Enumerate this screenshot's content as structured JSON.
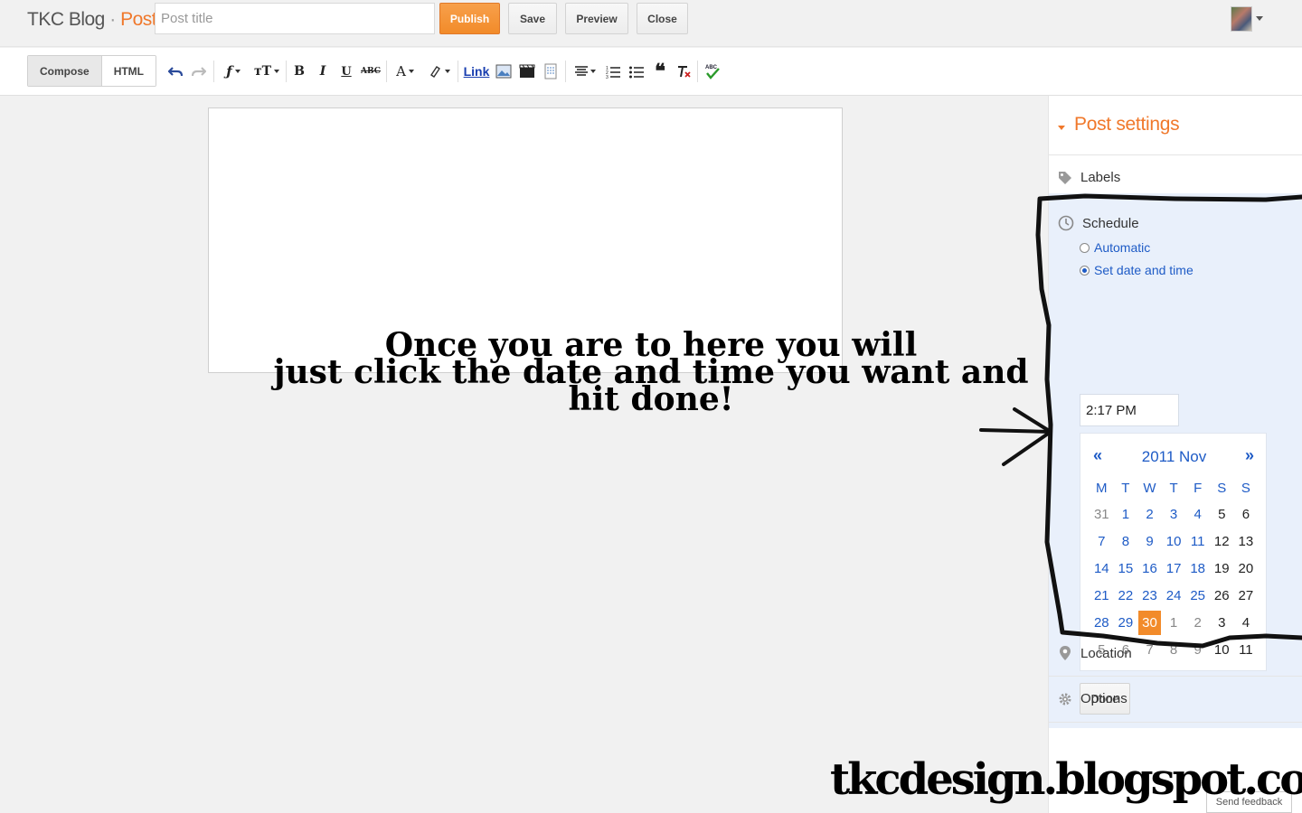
{
  "header": {
    "blog_name": "TKC Blog",
    "separator": "·",
    "page_label": "Post",
    "title_placeholder": "Post title",
    "buttons": {
      "publish": "Publish",
      "save": "Save",
      "preview": "Preview",
      "close": "Close"
    }
  },
  "toolbar": {
    "tabs": {
      "compose": "Compose",
      "html": "HTML"
    },
    "link_label": "Link",
    "bold": "B",
    "italic": "I",
    "underline": "U",
    "strike": "ABC",
    "text_color": "A"
  },
  "annotation": {
    "line1": "Once you are to here you will",
    "line2": "just click the date and time you want and",
    "line3": "hit done!"
  },
  "sidebar": {
    "title": "Post settings",
    "labels": "Labels",
    "schedule": {
      "title": "Schedule",
      "option_automatic": "Automatic",
      "option_set": "Set date and time",
      "selected_option": "Set date and time",
      "time": "2:17 PM",
      "calendar": {
        "prev": "«",
        "next": "»",
        "month_title": "2011 Nov",
        "weekdays": [
          "M",
          "T",
          "W",
          "T",
          "F",
          "S",
          "S"
        ],
        "weeks": [
          [
            "31",
            "1",
            "2",
            "3",
            "4",
            "5",
            "6"
          ],
          [
            "7",
            "8",
            "9",
            "10",
            "11",
            "12",
            "13"
          ],
          [
            "14",
            "15",
            "16",
            "17",
            "18",
            "19",
            "20"
          ],
          [
            "21",
            "22",
            "23",
            "24",
            "25",
            "26",
            "27"
          ],
          [
            "28",
            "29",
            "30",
            "1",
            "2",
            "3",
            "4"
          ],
          [
            "5",
            "6",
            "7",
            "8",
            "9",
            "10",
            "11"
          ]
        ],
        "selected_day": "30"
      },
      "done": "Done"
    },
    "location": "Location",
    "options": "Options"
  },
  "footer": {
    "watermark": "tkcdesign.blogspot.com",
    "feedback": "Send feedback"
  },
  "colors": {
    "accent": "#f0782b",
    "link": "#1e5bc6",
    "schedule_bg": "#e9f0fb"
  }
}
